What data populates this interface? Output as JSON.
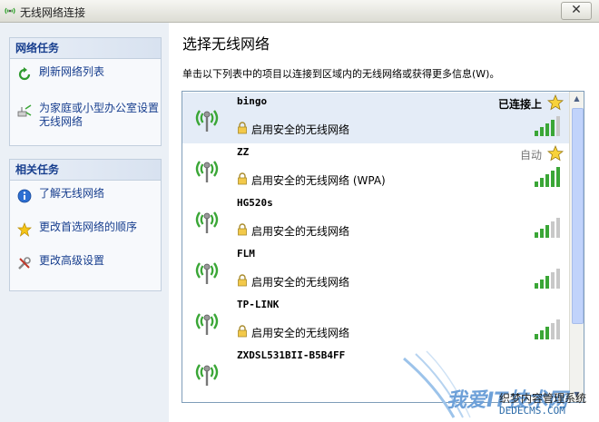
{
  "window": {
    "title": "无线网络连接",
    "close_label": "✕"
  },
  "sidebar": {
    "network_tasks": {
      "heading": "网络任务",
      "items": [
        {
          "label": "刷新网络列表",
          "icon": "refresh-icon"
        },
        {
          "label": "为家庭或小型办公室设置无线网络",
          "icon": "setup-icon"
        }
      ]
    },
    "related_tasks": {
      "heading": "相关任务",
      "items": [
        {
          "label": "了解无线网络",
          "icon": "info-icon"
        },
        {
          "label": "更改首选网络的顺序",
          "icon": "star-icon"
        },
        {
          "label": "更改高级设置",
          "icon": "tools-icon"
        }
      ]
    }
  },
  "main": {
    "title": "选择无线网络",
    "description": "单击以下列表中的项目以连接到区域内的无线网络或获得更多信息(W)。",
    "networks": [
      {
        "name": "bingo",
        "status": "已连接上",
        "security": "启用安全的无线网络",
        "signal": 4,
        "starred": true
      },
      {
        "name": "ZZ",
        "status": "自动",
        "security": "启用安全的无线网络 (WPA)",
        "signal": 5,
        "starred": true
      },
      {
        "name": "HG520s",
        "status": "",
        "security": "启用安全的无线网络",
        "signal": 3,
        "starred": false
      },
      {
        "name": "FLM",
        "status": "",
        "security": "启用安全的无线网络",
        "signal": 3,
        "starred": false
      },
      {
        "name": "TP-LINK",
        "status": "",
        "security": "启用安全的无线网络",
        "signal": 3,
        "starred": false
      },
      {
        "name": "ZXDSL531BII-B5B4FF",
        "status": "",
        "security": "",
        "signal": 0,
        "starred": false
      }
    ]
  },
  "watermark": {
    "brand": "我爱IT技术网",
    "line1": "织梦内容管理系统",
    "line2": "DEDECMS.COM"
  },
  "colors": {
    "accent": "#173e8e",
    "signal_on": "#3aa636",
    "signal_off": "#c8c8c8",
    "selected_row": "#e4ecf7"
  }
}
